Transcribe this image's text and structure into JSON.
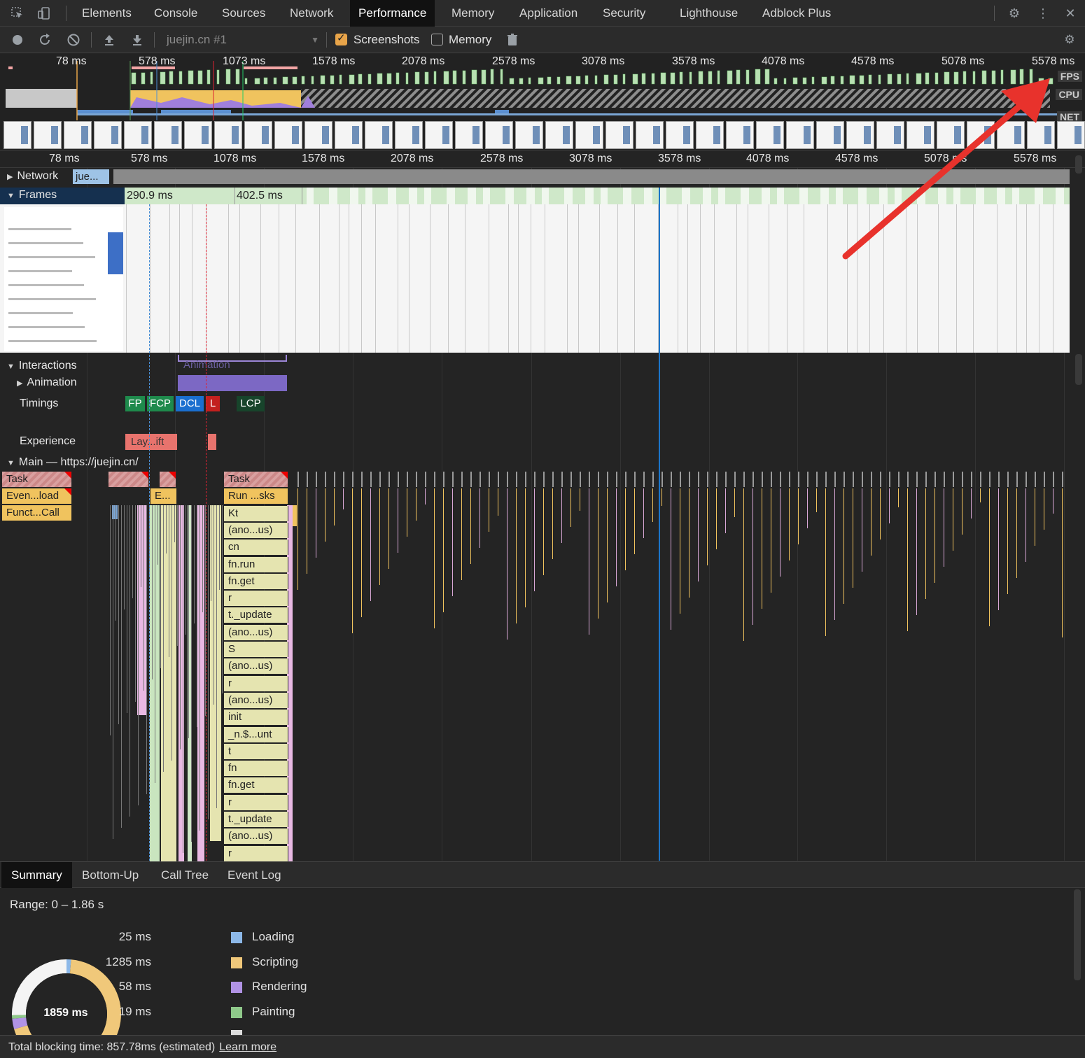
{
  "tabs": {
    "items": [
      "Elements",
      "Console",
      "Sources",
      "Network",
      "Performance",
      "Memory",
      "Application",
      "Security",
      "Lighthouse",
      "Adblock Plus"
    ],
    "active": "Performance"
  },
  "toolbar": {
    "target": "juejin.cn #1",
    "screenshots_label": "Screenshots",
    "screenshots_checked": true,
    "memory_label": "Memory",
    "memory_checked": false
  },
  "overview": {
    "ticks": [
      "78 ms",
      "578 ms",
      "1073 ms",
      "1578 ms",
      "2078 ms",
      "2578 ms",
      "3078 ms",
      "3578 ms",
      "4078 ms",
      "4578 ms",
      "5078 ms",
      "5578 ms"
    ],
    "labels": {
      "fps": "FPS",
      "cpu": "CPU",
      "net": "NET"
    }
  },
  "ruler": {
    "ticks": [
      "78 ms",
      "578 ms",
      "1078 ms",
      "1578 ms",
      "2078 ms",
      "2578 ms",
      "3078 ms",
      "3578 ms",
      "4078 ms",
      "4578 ms",
      "5078 ms",
      "5578 ms"
    ]
  },
  "tracks": {
    "network": {
      "label": "Network",
      "first_item": "jue..."
    },
    "frames": {
      "label": "Frames",
      "frame1": "290.9 ms",
      "frame2": "402.5 ms"
    },
    "interactions": {
      "label": "Interactions",
      "ghost": "Animation"
    },
    "animation": {
      "label": "Animation"
    },
    "timings": {
      "label": "Timings",
      "markers": [
        "FP",
        "FCP",
        "DCL",
        "L",
        "LCP"
      ]
    },
    "experience": {
      "label": "Experience",
      "item": "Lay...ift"
    },
    "main": {
      "label": "Main — https://juejin.cn/"
    }
  },
  "flame_left": [
    "Task",
    "Even...load",
    "Funct...Call"
  ],
  "flame_mid": {
    "task": "Task",
    "ev": "E..."
  },
  "flame_stack": [
    "Task",
    "Run ...sks",
    "Kt",
    "(ano...us)",
    "cn",
    "fn.run",
    "fn.get",
    "r",
    "t._update",
    "(ano...us)",
    "S",
    "(ano...us)",
    "r",
    "(ano...us)",
    "init",
    "_n.$...unt",
    "t",
    "fn",
    "fn.get",
    "r",
    "t._update",
    "(ano...us)",
    "r"
  ],
  "bottom_tabs": {
    "items": [
      "Summary",
      "Bottom-Up",
      "Call Tree",
      "Event Log"
    ],
    "active": "Summary"
  },
  "summary": {
    "range": "Range: 0 – 1.86 s",
    "total": "1859 ms",
    "legend": [
      {
        "value": "25 ms",
        "name": "Loading",
        "color": "#8cb8e8"
      },
      {
        "value": "1285 ms",
        "name": "Scripting",
        "color": "#f0c87a"
      },
      {
        "value": "58 ms",
        "name": "Rendering",
        "color": "#b193e5"
      },
      {
        "value": "19 ms",
        "name": "Painting",
        "color": "#8fc98a"
      }
    ]
  },
  "footer": {
    "text": "Total blocking time: 857.78ms (estimated)",
    "link": "Learn more"
  },
  "colors": {
    "annotation_arrow": "#e8322c",
    "scripting": "#f0c35e",
    "rendering": "#b193e5",
    "loading": "#8cb8e8",
    "painting": "#8fc98a"
  }
}
